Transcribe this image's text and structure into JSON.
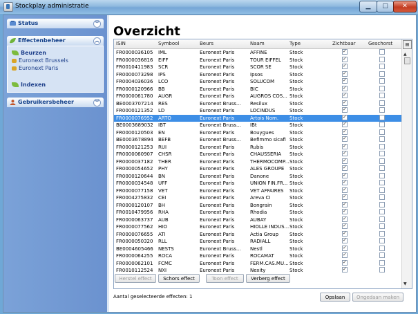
{
  "window": {
    "title": "Stockplay administratie",
    "min_glyph": "▁",
    "max_glyph": "□",
    "close_glyph": "✕"
  },
  "sidebar": {
    "status": {
      "label": "Status",
      "toggle": "︾"
    },
    "effecten": {
      "label": "Effectenbeheer",
      "toggle": "︽",
      "items": [
        {
          "label": "Beurzen"
        },
        {
          "label": "Euronext Brussels"
        },
        {
          "label": "Euronext Paris"
        },
        {
          "label": "Indexen"
        }
      ]
    },
    "gebruikers": {
      "label": "Gebruikersbeheer",
      "toggle": "︾"
    }
  },
  "main": {
    "title": "Overzicht",
    "columns": [
      "ISIN",
      "Symbool",
      "Beurs",
      "Naam",
      "Type",
      "Zichtbaar",
      "Geschorst"
    ],
    "rows": [
      {
        "isin": "FR0000036105",
        "symbool": "IML",
        "beurs": "Euronext Paris",
        "naam": "AFFINE",
        "type": "Stock",
        "zichtbaar": true,
        "geschorst": false
      },
      {
        "isin": "FR0000036816",
        "symbool": "EIFF",
        "beurs": "Euronext Paris",
        "naam": "TOUR EIFFEL",
        "type": "Stock",
        "zichtbaar": true,
        "geschorst": false
      },
      {
        "isin": "FR0010411983",
        "symbool": "SCR",
        "beurs": "Euronext Paris",
        "naam": "SCOR SE",
        "type": "Stock",
        "zichtbaar": true,
        "geschorst": false
      },
      {
        "isin": "FR0000073298",
        "symbool": "IPS",
        "beurs": "Euronext Paris",
        "naam": "Ipsos",
        "type": "Stock",
        "zichtbaar": true,
        "geschorst": false
      },
      {
        "isin": "FR0004036036",
        "symbool": "LCO",
        "beurs": "Euronext Paris",
        "naam": "SOLUCOM",
        "type": "Stock",
        "zichtbaar": true,
        "geschorst": false
      },
      {
        "isin": "FR0000120966",
        "symbool": "BB",
        "beurs": "Euronext Paris",
        "naam": "BIC",
        "type": "Stock",
        "zichtbaar": true,
        "geschorst": false
      },
      {
        "isin": "FR0000061780",
        "symbool": "AUGR",
        "beurs": "Euronext Paris",
        "naam": "AUGROS COS...",
        "type": "Stock",
        "zichtbaar": true,
        "geschorst": false
      },
      {
        "isin": "BE0003707214",
        "symbool": "RES",
        "beurs": "Euronext Bruss...",
        "naam": "Resilux",
        "type": "Stock",
        "zichtbaar": true,
        "geschorst": false
      },
      {
        "isin": "FR0000121352",
        "symbool": "LD",
        "beurs": "Euronext Paris",
        "naam": "LOCINDUS",
        "type": "Stock",
        "zichtbaar": true,
        "geschorst": false
      },
      {
        "isin": "FR0000076952",
        "symbool": "ARTO",
        "beurs": "Euronext Paris",
        "naam": "Artois Nom.",
        "type": "Stock",
        "zichtbaar": true,
        "geschorst": false,
        "selected": true
      },
      {
        "isin": "BE0003689032",
        "symbool": "IBT",
        "beurs": "Euronext Bruss...",
        "naam": "IBt",
        "type": "Stock",
        "zichtbaar": true,
        "geschorst": false
      },
      {
        "isin": "FR0000120503",
        "symbool": "EN",
        "beurs": "Euronext Paris",
        "naam": "Bouygues",
        "type": "Stock",
        "zichtbaar": true,
        "geschorst": false
      },
      {
        "isin": "BE0003678894",
        "symbool": "BEFB",
        "beurs": "Euronext Bruss...",
        "naam": "Befimmo sicafi",
        "type": "Stock",
        "zichtbaar": true,
        "geschorst": false
      },
      {
        "isin": "FR0000121253",
        "symbool": "RUI",
        "beurs": "Euronext Paris",
        "naam": "Rubis",
        "type": "Stock",
        "zichtbaar": true,
        "geschorst": false
      },
      {
        "isin": "FR0000060907",
        "symbool": "CHSR",
        "beurs": "Euronext Paris",
        "naam": "CHAUSSERIA",
        "type": "Stock",
        "zichtbaar": true,
        "geschorst": false
      },
      {
        "isin": "FR0000037182",
        "symbool": "THER",
        "beurs": "Euronext Paris",
        "naam": "THERMOCOMP...",
        "type": "Stock",
        "zichtbaar": true,
        "geschorst": false
      },
      {
        "isin": "FR0000054652",
        "symbool": "PHY",
        "beurs": "Euronext Paris",
        "naam": "ALES GROUPE",
        "type": "Stock",
        "zichtbaar": true,
        "geschorst": false
      },
      {
        "isin": "FR0000120644",
        "symbool": "BN",
        "beurs": "Euronext Paris",
        "naam": "Danone",
        "type": "Stock",
        "zichtbaar": true,
        "geschorst": false
      },
      {
        "isin": "FR0000034548",
        "symbool": "UFF",
        "beurs": "Euronext Paris",
        "naam": "UNION FIN.FR...",
        "type": "Stock",
        "zichtbaar": true,
        "geschorst": false
      },
      {
        "isin": "FR0000077158",
        "symbool": "VET",
        "beurs": "Euronext Paris",
        "naam": "VET AFFAIRES",
        "type": "Stock",
        "zichtbaar": true,
        "geschorst": false
      },
      {
        "isin": "FR0004275832",
        "symbool": "CEI",
        "beurs": "Euronext Paris",
        "naam": "Areva CI",
        "type": "Stock",
        "zichtbaar": true,
        "geschorst": false
      },
      {
        "isin": "FR0000120107",
        "symbool": "BH",
        "beurs": "Euronext Paris",
        "naam": "Bongrain",
        "type": "Stock",
        "zichtbaar": true,
        "geschorst": false
      },
      {
        "isin": "FR0010479956",
        "symbool": "RHA",
        "beurs": "Euronext Paris",
        "naam": "Rhodia",
        "type": "Stock",
        "zichtbaar": true,
        "geschorst": false
      },
      {
        "isin": "FR0000063737",
        "symbool": "AUB",
        "beurs": "Euronext Paris",
        "naam": "AUBAY",
        "type": "Stock",
        "zichtbaar": true,
        "geschorst": false
      },
      {
        "isin": "FR0000077562",
        "symbool": "HIO",
        "beurs": "Euronext Paris",
        "naam": "HIOLLE INDUS...",
        "type": "Stock",
        "zichtbaar": true,
        "geschorst": false
      },
      {
        "isin": "FR0000076655",
        "symbool": "ATI",
        "beurs": "Euronext Paris",
        "naam": "Actia Group",
        "type": "Stock",
        "zichtbaar": true,
        "geschorst": false
      },
      {
        "isin": "FR0000050320",
        "symbool": "RLL",
        "beurs": "Euronext Paris",
        "naam": "RADIALL",
        "type": "Stock",
        "zichtbaar": true,
        "geschorst": false
      },
      {
        "isin": "BE0004605466",
        "symbool": "NESTS",
        "beurs": "Euronext Bruss...",
        "naam": "Nestl",
        "type": "Stock",
        "zichtbaar": true,
        "geschorst": false
      },
      {
        "isin": "FR0000064255",
        "symbool": "ROCA",
        "beurs": "Euronext Paris",
        "naam": "ROCAMAT",
        "type": "Stock",
        "zichtbaar": true,
        "geschorst": false
      },
      {
        "isin": "FR0000062101",
        "symbool": "FCMC",
        "beurs": "Euronext Paris",
        "naam": "FERM.CAS.MU...",
        "type": "Stock",
        "zichtbaar": true,
        "geschorst": false
      },
      {
        "isin": "FR0010112524",
        "symbool": "NXI",
        "beurs": "Euronext Paris",
        "naam": "Nexity",
        "type": "Stock",
        "zichtbaar": true,
        "geschorst": false
      }
    ],
    "buttons": {
      "herstel": "Herstel effect",
      "schors": "Schors effect",
      "toon": "Toon effect",
      "verberg": "Verberg effect",
      "opslaan": "Opslaan",
      "ongedaan": "Ongedaan maken"
    },
    "status_text": "Aantal geselecteerde effecten: 1",
    "scroll": {
      "col_glyph": "▤",
      "up_glyph": "▲",
      "down_glyph": "▼"
    }
  }
}
